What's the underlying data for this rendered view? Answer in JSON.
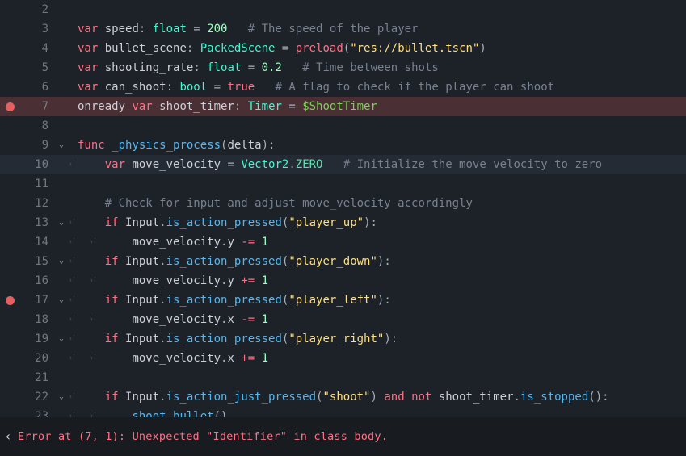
{
  "lines": [
    {
      "n": 2
    },
    {
      "n": 3
    },
    {
      "n": 4
    },
    {
      "n": 5
    },
    {
      "n": 6
    },
    {
      "n": 7
    },
    {
      "n": 8
    },
    {
      "n": 9
    },
    {
      "n": 10
    },
    {
      "n": 11
    },
    {
      "n": 12
    },
    {
      "n": 13
    },
    {
      "n": 14
    },
    {
      "n": 15
    },
    {
      "n": 16
    },
    {
      "n": 17
    },
    {
      "n": 18
    },
    {
      "n": 19
    },
    {
      "n": 20
    },
    {
      "n": 21
    },
    {
      "n": 22
    },
    {
      "n": 23
    }
  ],
  "code": {
    "l3": {
      "kw": "var",
      "id": " speed",
      "col": ": ",
      "type": "float",
      "eq": " = ",
      "num": "200",
      "com": "   # The speed of the player"
    },
    "l4": {
      "kw": "var",
      "id": " bullet_scene",
      "col": ": ",
      "type": "PackedScene",
      "eq": " = ",
      "fn": "preload",
      "op": "(",
      "str": "\"res://bullet.tscn\"",
      "cp": ")"
    },
    "l5": {
      "kw": "var",
      "id": " shooting_rate",
      "col": ": ",
      "type": "float",
      "eq": " = ",
      "num": "0.2",
      "com": "   # Time between shots"
    },
    "l6": {
      "kw": "var",
      "id": " can_shoot",
      "col": ": ",
      "type": "bool",
      "eq": " = ",
      "val": "true",
      "com": "   # A flag to check if the player can shoot"
    },
    "l7": {
      "kw0": "onready ",
      "kw": "var",
      "id": " shoot_timer",
      "col": ": ",
      "type": "Timer",
      "eq": " = ",
      "node": "$ShootTimer"
    },
    "l9": {
      "kw": "func",
      "sp": " ",
      "name": "_physics_process",
      "op": "(",
      "arg": "delta",
      "cp": "):"
    },
    "l10": {
      "kw": "var",
      "id": " move_velocity ",
      "eq": "= ",
      "type": "Vector2",
      "dot": ".",
      "const": "ZERO",
      "com": "   # Initialize the move velocity to zero"
    },
    "l12": {
      "com": "# Check for input and adjust move_velocity accordingly"
    },
    "l13": {
      "kw": "if",
      "sp": " ",
      "obj": "Input",
      "dot": ".",
      "fn": "is_action_pressed",
      "op": "(",
      "str": "\"player_up\"",
      "cp": "):"
    },
    "l14": {
      "id": "move_velocity",
      "dot": ".",
      "mem": "y ",
      "op": "-=",
      "sp": " ",
      "num": "1"
    },
    "l15": {
      "kw": "if",
      "sp": " ",
      "obj": "Input",
      "dot": ".",
      "fn": "is_action_pressed",
      "op": "(",
      "str": "\"player_down\"",
      "cp": "):"
    },
    "l16": {
      "id": "move_velocity",
      "dot": ".",
      "mem": "y ",
      "op": "+=",
      "sp": " ",
      "num": "1"
    },
    "l17": {
      "kw": "if",
      "sp": " ",
      "obj": "Input",
      "dot": ".",
      "fn": "is_action_pressed",
      "op": "(",
      "str": "\"player_left\"",
      "cp": "):"
    },
    "l18": {
      "id": "move_velocity",
      "dot": ".",
      "mem": "x ",
      "op": "-=",
      "sp": " ",
      "num": "1"
    },
    "l19": {
      "kw": "if",
      "sp": " ",
      "obj": "Input",
      "dot": ".",
      "fn": "is_action_pressed",
      "op": "(",
      "str": "\"player_right\"",
      "cp": "):"
    },
    "l20": {
      "id": "move_velocity",
      "dot": ".",
      "mem": "x ",
      "op": "+=",
      "sp": " ",
      "num": "1"
    },
    "l22": {
      "kw": "if",
      "sp": " ",
      "obj": "Input",
      "dot": ".",
      "fn": "is_action_just_pressed",
      "op": "(",
      "str": "\"shoot\"",
      "cp": ") ",
      "and": "and",
      "sp2": " ",
      "not": "not",
      "sp3": " ",
      "obj2": "shoot_timer",
      "dot2": ".",
      "fn2": "is_stopped",
      "cp2": "():"
    },
    "l23": {
      "fn": "shoot_bullet",
      "cp": "()"
    }
  },
  "error": {
    "msg": "Error at (7, 1): Unexpected \"Identifier\" in class body."
  }
}
